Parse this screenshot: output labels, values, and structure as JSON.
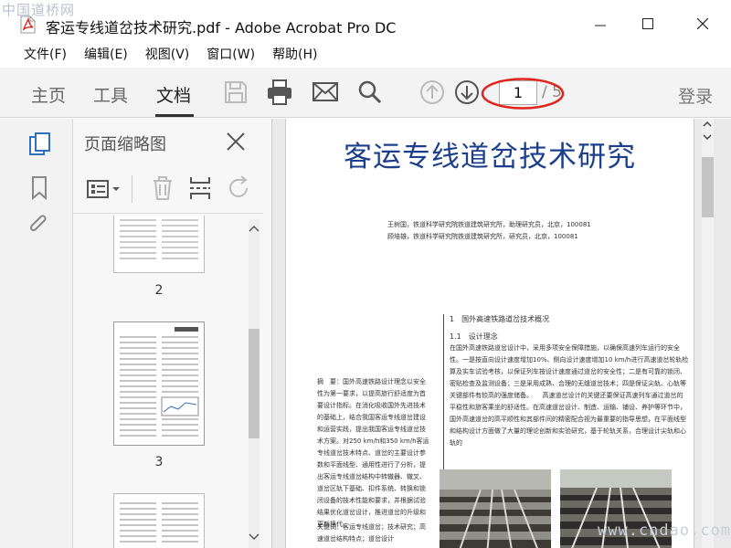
{
  "watermark": "中国道桥网",
  "bottom_watermark": "www.cndao.com",
  "window": {
    "title": "客运专线道岔技术研究.pdf - Adobe Acrobat Pro DC"
  },
  "menu": [
    "文件(F)",
    "编辑(E)",
    "视图(V)",
    "窗口(W)",
    "帮助(H)"
  ],
  "toolbar": {
    "tabs": [
      "主页",
      "工具",
      "文档"
    ],
    "active_tab": "文档",
    "current_page": "1",
    "total_pages": "/ 5",
    "login": "登录",
    "icons": [
      "save-icon",
      "print-icon",
      "email-icon",
      "search-icon",
      "page-up-icon",
      "page-down-icon"
    ]
  },
  "left_rail": {
    "icons": [
      "page-thumbnails-icon",
      "bookmark-icon",
      "attachment-icon"
    ]
  },
  "thumbnail_panel": {
    "title": "页面缩略图",
    "tools": [
      "thumbnail-options-icon",
      "delete-icon",
      "extract-pages-icon",
      "rotate-icon"
    ],
    "pages": [
      "2",
      "3"
    ]
  },
  "document": {
    "title": "客运专线道岔技术研究",
    "authors": [
      "王树国，铁道科学研究院铁道建筑研究所，助理研究员，北京，100081",
      "顾培雄，铁道科学研究院铁道建筑研究所，研究员，北京，100081"
    ],
    "section1": "1　国外高速铁路道岔技术概况",
    "section1_1": "1.1　设计理念",
    "para_right": "在国外高速铁路道岔设计中，采用多项安全保障措施，以确保高速列车运行的安全性。一是按直向设计速度增加10%、侧向设计速度增加10 km/h进行高速道岔轮轨检算及实车试验考核，以保证列车按设计速度通过道岔的安全性；二是有可靠的锁闭、密贴检查及监测设备；三是采用成熟、合理的无缝道岔技术；四是保证尖轨、心轨等关键部件有较高的强度储备。　　高速道岔设计的关键还要保证高速列车通过道岔的平稳性和旅客乘坐的舒适性。在高速道岔设计、制造、运输、铺设、养护等环节中，国外高速道岔的高平顺性和其部件间的精密配合视为最重要的指导思想，在平面线型和结构设计方面做了大量的理论创新和实验研究，基于轮轨关系，合理设计尖轨和心轨的",
    "para_left": "摘　要：国外高速铁路设计理念以安全性为第一要求，以提高旅行舒适度为首要设计指标。在消化吸收国外先进技术的基础上，结合我国客运专线道岔建设和运营实践，提出我国客运专线道岔技术方案。对250 km/h和350 km/h客运专线道岔技术特点、道岔的主要设计参数和平面线型、通用性进行了分析，提出客运专线道岔结构中转辙器、辙叉、道岔区轨下基础、扣件系统、转换和锁闭设备的技术性能和要求，并根据试验结果优化道岔设计，推进道岔的升级和更新换代。",
    "keywords": "关键词：客运专线道岔；技术研究；高速道岔结构特点；道岔设计"
  },
  "colors": {
    "title_blue": "#1c3f8c",
    "annotation_red": "#e0241d"
  }
}
